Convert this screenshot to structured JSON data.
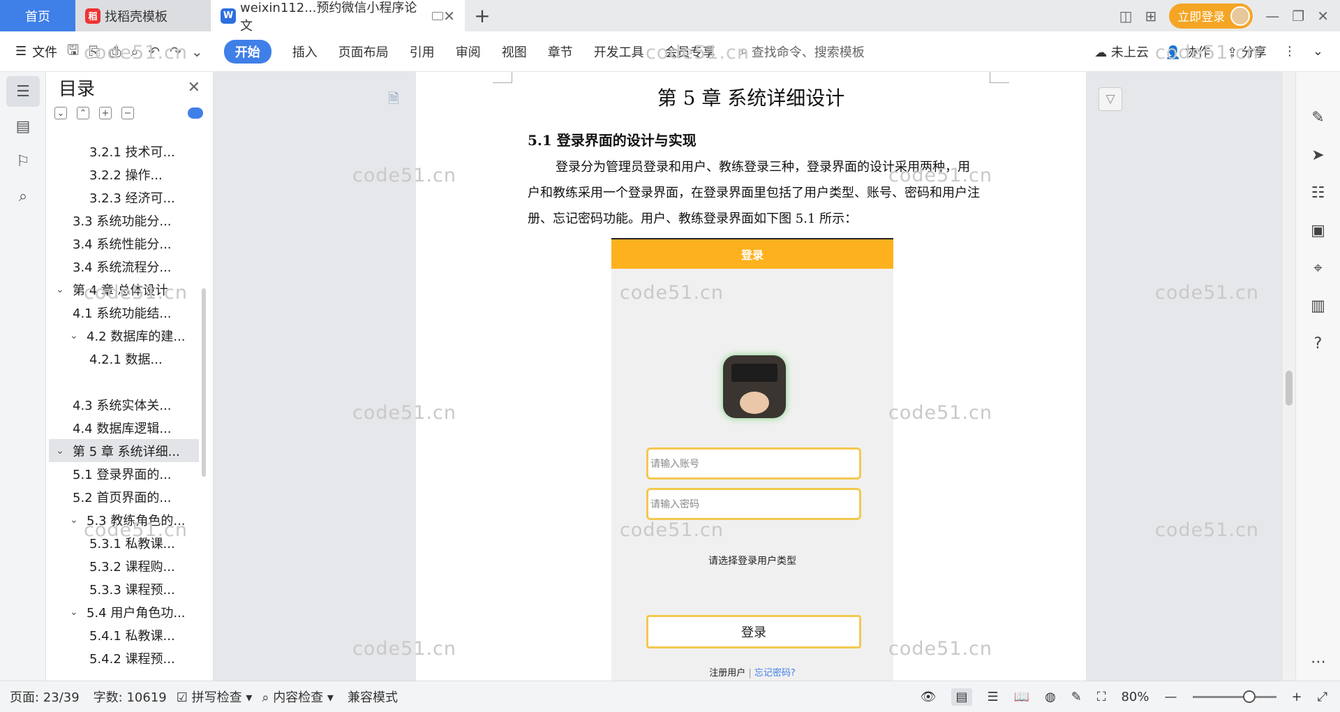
{
  "tabs": {
    "home": "首页",
    "template": "找稻壳模板",
    "doc": "weixin112...预约微信小程序论文"
  },
  "account": {
    "login": "立即登录"
  },
  "toolbar": {
    "file": "文件",
    "ribbon": [
      "开始",
      "插入",
      "页面布局",
      "引用",
      "审阅",
      "视图",
      "章节",
      "开发工具",
      "会员专享"
    ],
    "search_placeholder": "查找命令、搜索模板",
    "cloud": "未上云",
    "collab": "协作",
    "share": "分享"
  },
  "toc": {
    "title": "目录",
    "items": [
      {
        "label": "3.2.1 技术可...",
        "level": 3
      },
      {
        "label": "3.2.2  操作...",
        "level": 3
      },
      {
        "label": "3.2.3 经济可...",
        "level": 3
      },
      {
        "label": "3.3 系统功能分...",
        "level": 2
      },
      {
        "label": "3.4 系统性能分...",
        "level": 2
      },
      {
        "label": "3.4 系统流程分...",
        "level": 2
      },
      {
        "label": "第 4 章  总体设计",
        "level": 1,
        "expand": true
      },
      {
        "label": "4.1  系统功能结...",
        "level": 2
      },
      {
        "label": "4.2  数据库的建...",
        "level": 2,
        "expand": true
      },
      {
        "label": "4.2.1  数据...",
        "level": 3
      },
      {
        "label": "",
        "level": 3
      },
      {
        "label": "4.3 系统实体关...",
        "level": 2
      },
      {
        "label": "4.4 数据库逻辑...",
        "level": 2
      },
      {
        "label": "第 5 章  系统详细...",
        "level": 1,
        "expand": true,
        "selected": true
      },
      {
        "label": "5.1 登录界面的...",
        "level": 2
      },
      {
        "label": "5.2 首页界面的...",
        "level": 2
      },
      {
        "label": "5.3 教练角色的...",
        "level": 2,
        "expand": true
      },
      {
        "label": "5.3.1 私教课...",
        "level": 3
      },
      {
        "label": "5.3.2 课程购...",
        "level": 3
      },
      {
        "label": "5.3.3 课程预...",
        "level": 3
      },
      {
        "label": "5.4 用户角色功...",
        "level": 2,
        "expand": true
      },
      {
        "label": "5.4.1 私教课...",
        "level": 3
      },
      {
        "label": "5.4.2 课程预...",
        "level": 3
      }
    ]
  },
  "document": {
    "chapter_title": "第 5 章  系统详细设计",
    "section_title": "5.1 登录界面的设计与实现",
    "paragraph": "登录分为管理员登录和用户、教练登录三种，登录界面的设计采用两种，用户和教练采用一个登录界面，在登录界面里包括了用户类型、账号、密码和用户注册、忘记密码功能。用户、教练登录界面如下图 5.1 所示：",
    "watermark": "code51.cn",
    "mock": {
      "header": "登录",
      "account_placeholder": "请输入账号",
      "password_placeholder": "请输入密码",
      "user_type": "请选择登录用户类型",
      "login_button": "登录",
      "register": "注册用户",
      "separator": "|",
      "forgot": "忘记密码?"
    }
  },
  "status": {
    "page": "页面: 23/39",
    "words": "字数: 10619",
    "spell": "拼写检查",
    "content": "内容检查",
    "compat": "兼容模式",
    "zoom": "80%"
  }
}
